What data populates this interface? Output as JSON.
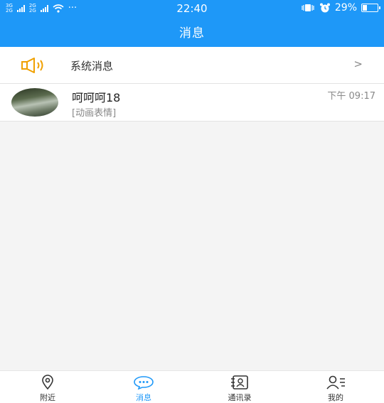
{
  "status_bar": {
    "net_top": "3G",
    "net_top_2": "2G",
    "net_bottom": "2G",
    "net_bottom_2": "2G",
    "dots": "···",
    "time": "22:40",
    "battery_percent": "29%",
    "battery_level": 0.29
  },
  "header": {
    "title": "消息"
  },
  "system_message": {
    "label": "系统消息",
    "chevron": ">"
  },
  "conversations": [
    {
      "name": "呵呵呵18",
      "preview": "[动画表情]",
      "time": "下午 09:17"
    }
  ],
  "tabs": [
    {
      "label": "附近",
      "icon": "location-pin-icon",
      "active": false
    },
    {
      "label": "消息",
      "icon": "chat-bubble-icon",
      "active": true
    },
    {
      "label": "通讯录",
      "icon": "contacts-book-icon",
      "active": false
    },
    {
      "label": "我的",
      "icon": "profile-icon",
      "active": false
    }
  ],
  "colors": {
    "accent": "#1e98f8",
    "speaker": "#f0a000"
  }
}
